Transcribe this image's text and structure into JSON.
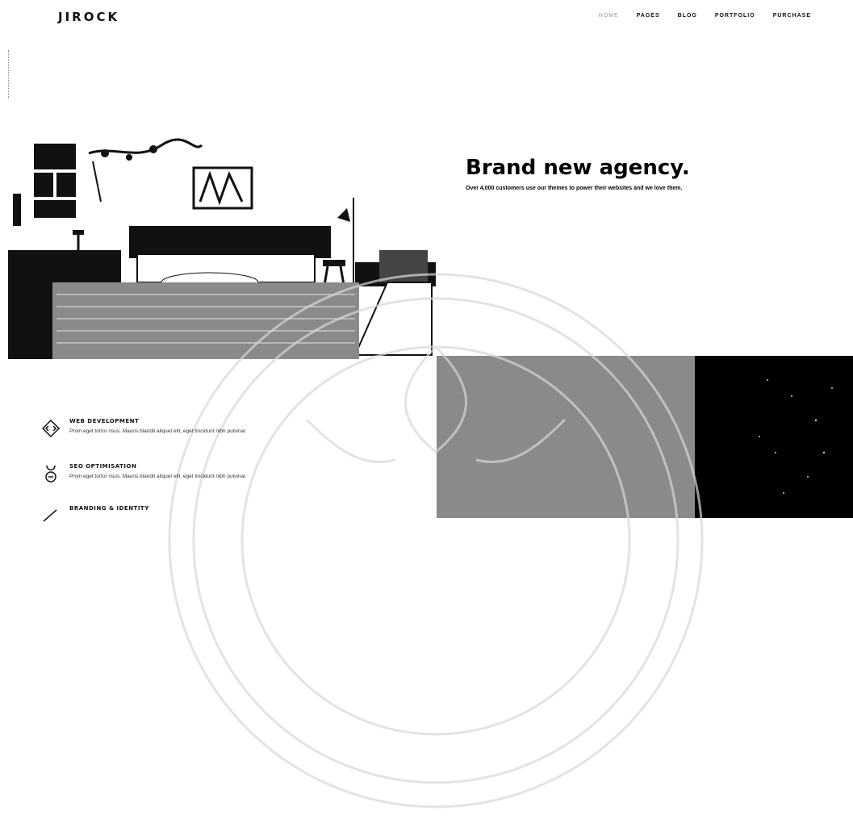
{
  "header": {
    "logo": "JIROCK",
    "nav": [
      "HOME",
      "PAGES",
      "BLOG",
      "PORTFOLIO",
      "PURCHASE"
    ]
  },
  "hero": {
    "title": "Brand new agency.",
    "subtitle": "Over 4,000 customers use our themes to power their websites and we love them."
  },
  "services": [
    {
      "icon": "code-icon",
      "title": "WEB DEVELOPMENT",
      "desc": "Proin eget tortor risus. Mauris blandit aliquet elit, eget tincidunt nibh pulvinar."
    },
    {
      "icon": "rocket-icon",
      "title": "SEO OPTIMISATION",
      "desc": "Proin eget tortor risus. Mauris blandit aliquet elit, eget tincidunt nibh pulvinar."
    },
    {
      "icon": "pen-icon",
      "title": "BRANDING & IDENTITY",
      "desc": ""
    }
  ],
  "colors": {
    "grey_block": "#8a8a8a",
    "black_block": "#000000"
  }
}
